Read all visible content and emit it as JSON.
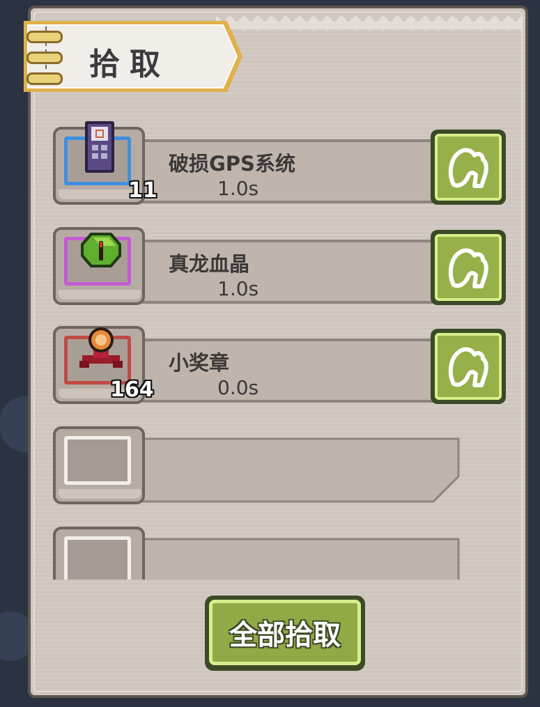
{
  "panel": {
    "title": "拾取",
    "pickup_all_label": "全部拾取"
  },
  "items": [
    {
      "name": "破损GPS系统",
      "time": "1.0s",
      "count": "11",
      "frame_color": "#3f8fe0",
      "icon": "gps-device-icon"
    },
    {
      "name": "真龙血晶",
      "time": "1.0s",
      "count": "",
      "frame_color": "#c45ad6",
      "icon": "dragon-crystal-icon"
    },
    {
      "name": "小奖章",
      "time": "0.0s",
      "count": "164",
      "frame_color": "#c04a44",
      "icon": "small-medal-icon"
    }
  ],
  "empty_slots": 2,
  "colors": {
    "accent_green": "#97b04a",
    "panel_bg": "#d2cac3",
    "banner_gold": "#e0b04a"
  }
}
